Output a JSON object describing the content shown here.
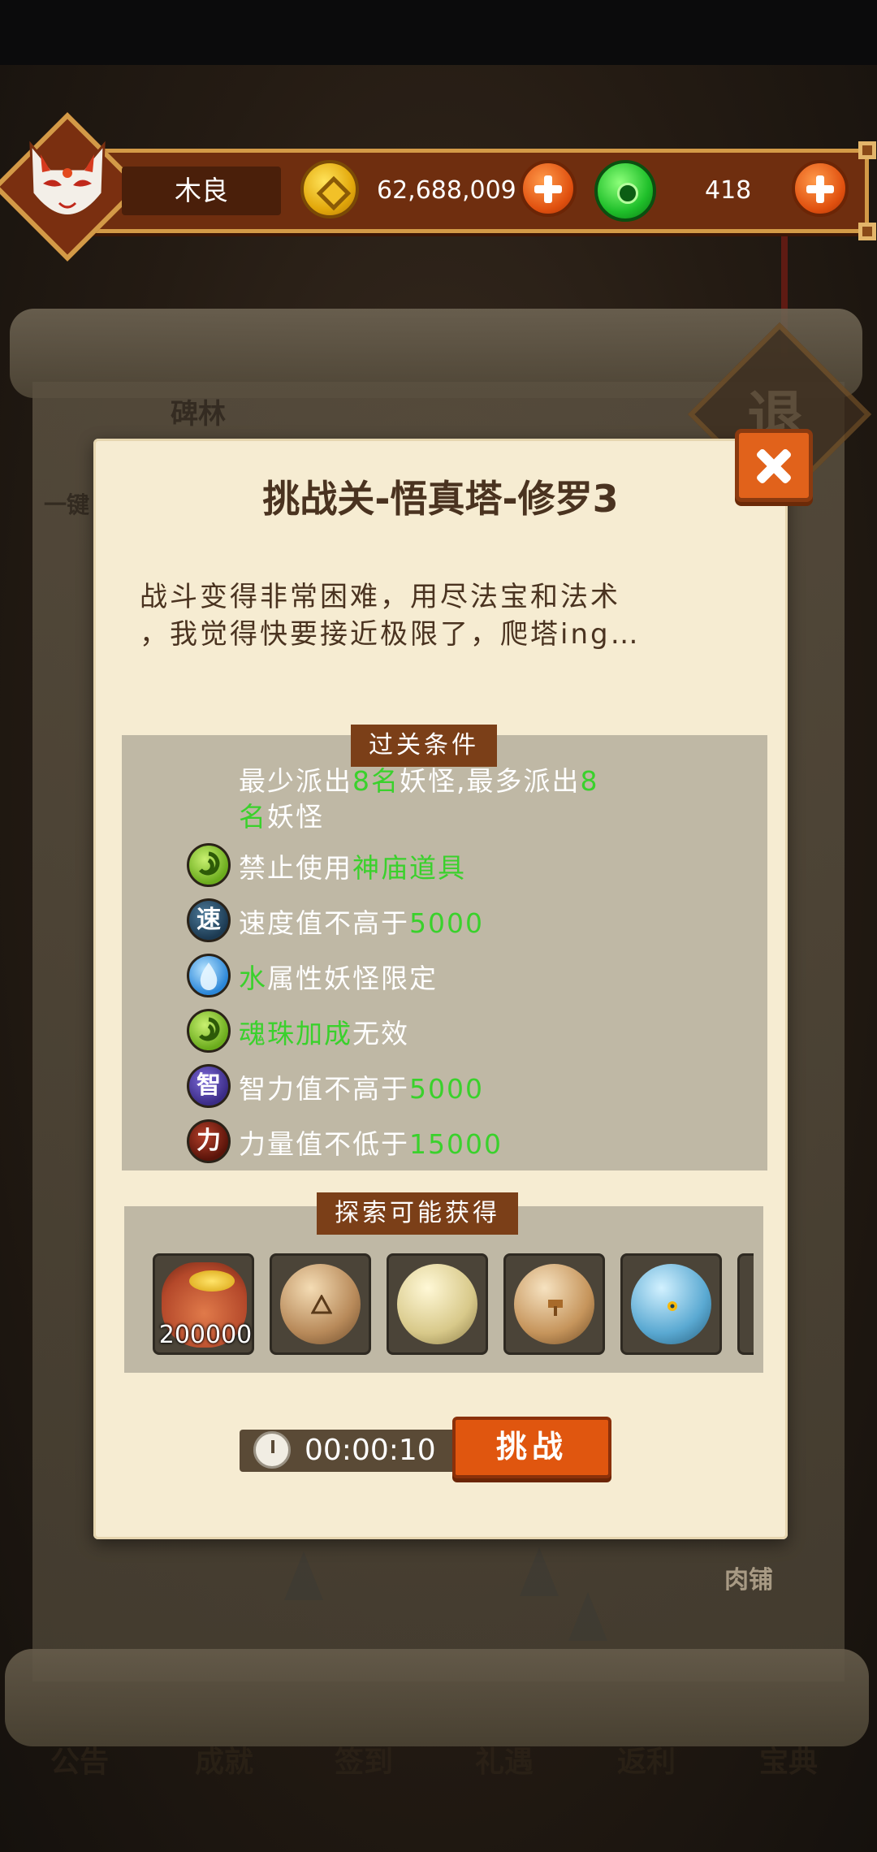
{
  "top_bar": {
    "player_name": "木良",
    "coins": "62,688,009",
    "jade": "418"
  },
  "background": {
    "labels": [
      "碑林",
      "一键"
    ],
    "diamond_char": "退",
    "shop_label": "肉铺",
    "nav_items": [
      "公告",
      "成就",
      "签到",
      "礼遇",
      "返利",
      "宝典"
    ]
  },
  "dialog": {
    "title": "挑战关-悟真塔-修罗3",
    "description_line1": "战斗变得非常困难，用尽法宝和法术",
    "description_line2": "，我觉得快要接近极限了，爬塔ing…",
    "conditions_header": "过关条件",
    "conditions": {
      "deploy": {
        "p1": "最少派出",
        "v1": "8名",
        "p2": "妖怪,最多派出",
        "v2": "8",
        "v3": "名",
        "p3": "妖怪"
      },
      "rule1": {
        "icon": "green-swirl-icon",
        "prefix": "禁止使用",
        "highlight": "神庙道具"
      },
      "rule2": {
        "icon_char": "速",
        "prefix": "速度值不高于",
        "highlight": "5000"
      },
      "rule3": {
        "icon": "water-drop-icon",
        "highlight": "水",
        "suffix": "属性妖怪限定"
      },
      "rule4": {
        "icon": "green-swirl-icon",
        "highlight": "魂珠加成",
        "suffix": "无效"
      },
      "rule5": {
        "icon_char": "智",
        "prefix": "智力值不高于",
        "highlight": "5000"
      },
      "rule6": {
        "icon_char": "力",
        "prefix": "力量值不低于",
        "highlight": "15000"
      }
    },
    "rewards_header": "探索可能获得",
    "rewards": [
      {
        "icon": "coin-bag-icon",
        "amount": "200000"
      },
      {
        "icon": "rock-rune-icon"
      },
      {
        "icon": "cream-stone-icon"
      },
      {
        "icon": "wooden-sign-icon"
      },
      {
        "icon": "blue-triangle-icon"
      }
    ],
    "timer": "00:00:10",
    "challenge_label": "挑战"
  },
  "colors": {
    "highlight": "#3ad12c",
    "button_orange": "#e0560f",
    "parchment": "#f6ecd2"
  }
}
